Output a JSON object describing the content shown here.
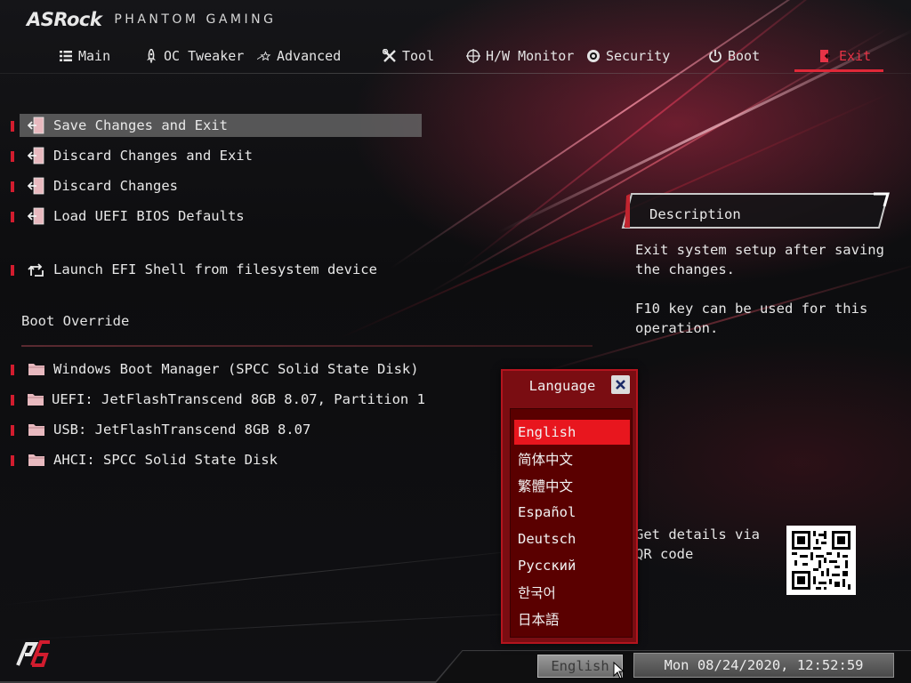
{
  "header": {
    "brand": "ASRock",
    "tagline": "PHANTOM GAMING"
  },
  "tabs": [
    {
      "label": "Main",
      "icon": "list-icon"
    },
    {
      "label": "OC Tweaker",
      "icon": "rocket-icon"
    },
    {
      "label": "Advanced",
      "icon": "star-icon"
    },
    {
      "label": "Tool",
      "icon": "tools-icon"
    },
    {
      "label": "H/W Monitor",
      "icon": "crosshair-icon"
    },
    {
      "label": "Security",
      "icon": "shield-icon"
    },
    {
      "label": "Boot",
      "icon": "power-icon"
    },
    {
      "label": "Exit",
      "icon": "exit-icon",
      "active": true
    }
  ],
  "menu": {
    "items": [
      {
        "label": "Save Changes and Exit",
        "icon": "exit-icon",
        "selected": true
      },
      {
        "label": "Discard Changes and Exit",
        "icon": "exit-icon"
      },
      {
        "label": "Discard Changes",
        "icon": "exit-icon"
      },
      {
        "label": "Load UEFI BIOS Defaults",
        "icon": "exit-icon"
      },
      {
        "label": "Launch EFI Shell from filesystem device",
        "icon": "shell-icon"
      }
    ],
    "boot_override_title": "Boot Override",
    "boot_items": [
      {
        "label": "Windows Boot Manager (SPCC Solid State Disk)",
        "icon": "folder-icon"
      },
      {
        "label": "UEFI: JetFlashTranscend 8GB 8.07, Partition 1",
        "icon": "folder-icon"
      },
      {
        "label": "USB: JetFlashTranscend 8GB 8.07",
        "icon": "folder-icon"
      },
      {
        "label": "AHCI:  SPCC Solid State Disk",
        "icon": "folder-icon"
      }
    ]
  },
  "description": {
    "title": "Description",
    "text": "Exit system setup after saving the changes.\n\nF10 key can be used for this operation.",
    "qr_text": "Get details via QR code"
  },
  "language_popup": {
    "title": "Language",
    "options": [
      "English",
      "简体中文",
      "繁體中文",
      "Español",
      "Deutsch",
      "Русский",
      "한국어",
      "日本語"
    ],
    "selected": "English"
  },
  "footer": {
    "language_button": "English",
    "datetime": "Mon 08/24/2020, 12:52:59"
  },
  "colors": {
    "accent": "#e02838",
    "popup_bg": "#7a0d12",
    "selected_lang": "#e8161e"
  }
}
